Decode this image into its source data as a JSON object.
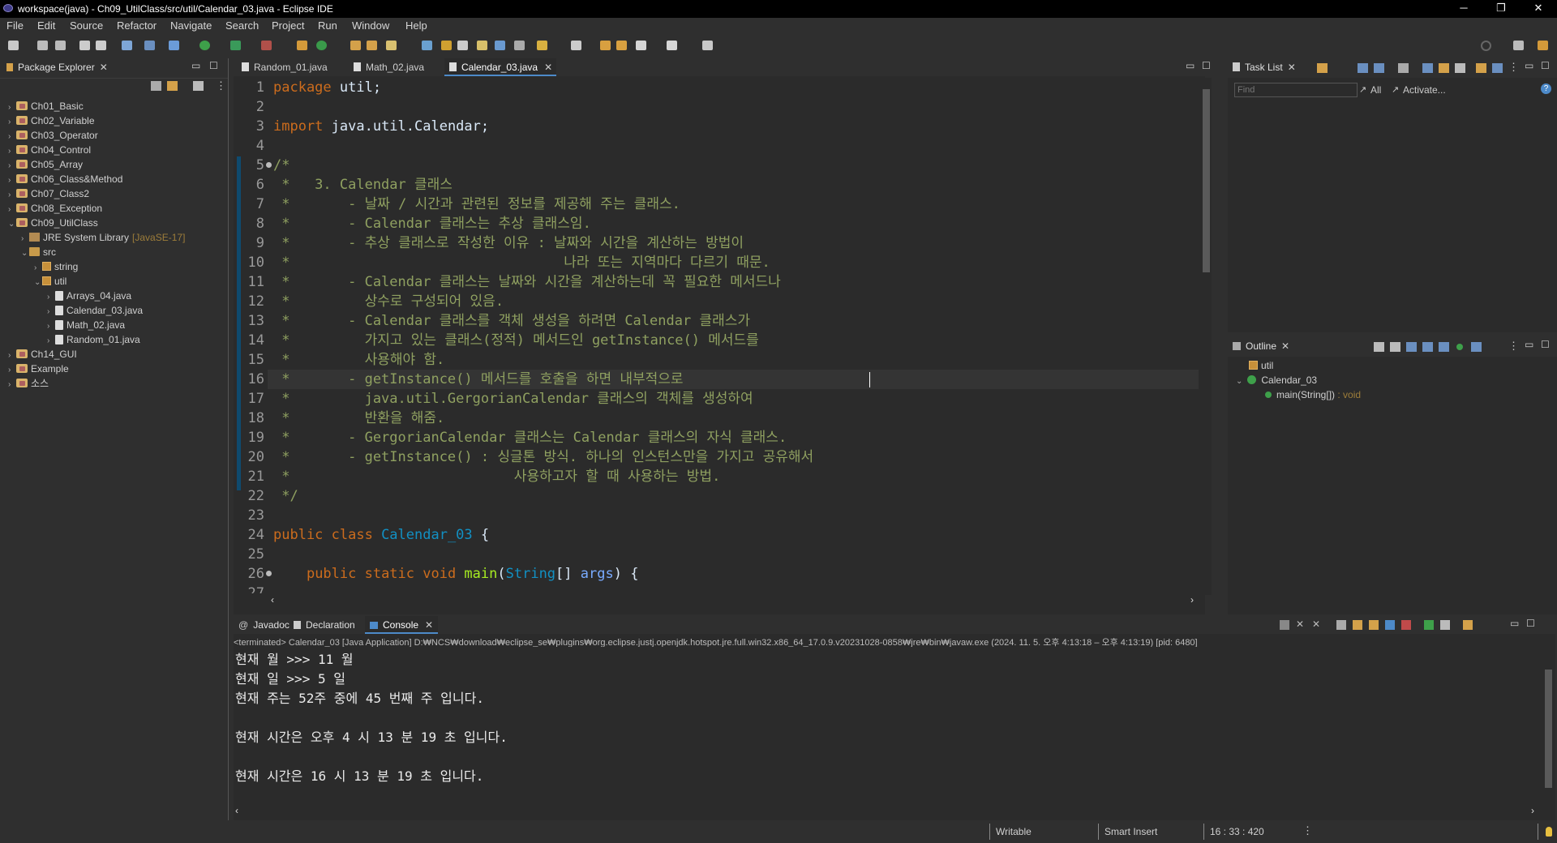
{
  "window": {
    "title": "workspace(java) - Ch09_UtilClass/src/util/Calendar_03.java - Eclipse IDE",
    "controls": [
      "─",
      "❐",
      "✕"
    ]
  },
  "menu": [
    "File",
    "Edit",
    "Source",
    "Refactor",
    "Navigate",
    "Search",
    "Project",
    "Run",
    "Window",
    "Help"
  ],
  "package_explorer": {
    "title": "Package Explorer",
    "tree": [
      {
        "label": "Ch01_Basic",
        "type": "project",
        "indent": 0,
        "arrow": "›"
      },
      {
        "label": "Ch02_Variable",
        "type": "project",
        "indent": 0,
        "arrow": "›"
      },
      {
        "label": "Ch03_Operator",
        "type": "project",
        "indent": 0,
        "arrow": "›"
      },
      {
        "label": "Ch04_Control",
        "type": "project",
        "indent": 0,
        "arrow": "›"
      },
      {
        "label": "Ch05_Array",
        "type": "project",
        "indent": 0,
        "arrow": "›"
      },
      {
        "label": "Ch06_Class&Method",
        "type": "project",
        "indent": 0,
        "arrow": "›"
      },
      {
        "label": "Ch07_Class2",
        "type": "project",
        "indent": 0,
        "arrow": "›"
      },
      {
        "label": "Ch08_Exception",
        "type": "project",
        "indent": 0,
        "arrow": "›"
      },
      {
        "label": "Ch09_UtilClass",
        "type": "project",
        "indent": 0,
        "arrow": "⌄"
      },
      {
        "label": "JRE System Library",
        "suffix": "[JavaSE-17]",
        "type": "library",
        "indent": 1,
        "arrow": "›"
      },
      {
        "label": "src",
        "type": "src",
        "indent": 1,
        "arrow": "⌄"
      },
      {
        "label": "string",
        "type": "package",
        "indent": 2,
        "arrow": "›"
      },
      {
        "label": "util",
        "type": "package",
        "indent": 2,
        "arrow": "⌄"
      },
      {
        "label": "Arrays_04.java",
        "type": "java",
        "indent": 3,
        "arrow": "›"
      },
      {
        "label": "Calendar_03.java",
        "type": "java",
        "indent": 3,
        "arrow": "›"
      },
      {
        "label": "Math_02.java",
        "type": "java",
        "indent": 3,
        "arrow": "›"
      },
      {
        "label": "Random_01.java",
        "type": "java",
        "indent": 3,
        "arrow": "›"
      },
      {
        "label": "Ch14_GUI",
        "type": "project",
        "indent": 0,
        "arrow": "›"
      },
      {
        "label": "Example",
        "type": "project",
        "indent": 0,
        "arrow": "›"
      },
      {
        "label": "소스",
        "type": "project",
        "indent": 0,
        "arrow": "›"
      }
    ]
  },
  "editor": {
    "tabs": [
      {
        "label": "Random_01.java",
        "active": false
      },
      {
        "label": "Math_02.java",
        "active": false
      },
      {
        "label": "Calendar_03.java",
        "active": true
      }
    ],
    "lines": [
      {
        "n": "1",
        "parts": [
          {
            "c": "kw",
            "t": "package"
          },
          {
            "c": "pl",
            "t": " util;"
          }
        ]
      },
      {
        "n": "2",
        "parts": []
      },
      {
        "n": "3",
        "parts": [
          {
            "c": "kw",
            "t": "import"
          },
          {
            "c": "pl",
            "t": " java.util.Calendar;"
          }
        ]
      },
      {
        "n": "4",
        "parts": []
      },
      {
        "n": "5",
        "fold": true,
        "parts": [
          {
            "c": "cm",
            "t": "/*"
          }
        ]
      },
      {
        "n": "6",
        "parts": [
          {
            "c": "cm",
            "t": " *   3. Calendar 클래스"
          }
        ]
      },
      {
        "n": "7",
        "parts": [
          {
            "c": "cm",
            "t": " *       - 날짜 / 시간과 관련된 정보를 제공해 주는 클래스."
          }
        ]
      },
      {
        "n": "8",
        "parts": [
          {
            "c": "cm",
            "t": " *       - Calendar 클래스는 추상 클래스임."
          }
        ]
      },
      {
        "n": "9",
        "parts": [
          {
            "c": "cm",
            "t": " *       - 추상 클래스로 작성한 이유 : 날짜와 시간을 계산하는 방법이"
          }
        ]
      },
      {
        "n": "10",
        "parts": [
          {
            "c": "cm",
            "t": " *                                 나라 또는 지역마다 다르기 때문."
          }
        ]
      },
      {
        "n": "11",
        "parts": [
          {
            "c": "cm",
            "t": " *       - Calendar 클래스는 날짜와 시간을 계산하는데 꼭 필요한 메서드나"
          }
        ]
      },
      {
        "n": "12",
        "parts": [
          {
            "c": "cm",
            "t": " *         상수로 구성되어 있음."
          }
        ]
      },
      {
        "n": "13",
        "parts": [
          {
            "c": "cm",
            "t": " *       - Calendar 클래스를 객체 생성을 하려면 Calendar 클래스가"
          }
        ]
      },
      {
        "n": "14",
        "parts": [
          {
            "c": "cm",
            "t": " *         가지고 있는 클래스(정적) 메서드인 getInstance() 메서드를"
          }
        ]
      },
      {
        "n": "15",
        "parts": [
          {
            "c": "cm",
            "t": " *         사용해야 함."
          }
        ]
      },
      {
        "n": "16",
        "current": true,
        "parts": [
          {
            "c": "cm",
            "t": " *       - getInstance() 메서드를 호출을 하면 내부적으로"
          }
        ]
      },
      {
        "n": "17",
        "parts": [
          {
            "c": "cm",
            "t": " *         java.util.GergorianCalendar 클래스의 객체를 생성하여"
          }
        ]
      },
      {
        "n": "18",
        "parts": [
          {
            "c": "cm",
            "t": " *         반환을 해줌."
          }
        ]
      },
      {
        "n": "19",
        "parts": [
          {
            "c": "cm",
            "t": " *       - GergorianCalendar 클래스는 Calendar 클래스의 자식 클래스."
          }
        ]
      },
      {
        "n": "20",
        "parts": [
          {
            "c": "cm",
            "t": " *       - getInstance() : 싱글톤 방식. 하나의 인스턴스만을 가지고 공유해서"
          }
        ]
      },
      {
        "n": "21",
        "parts": [
          {
            "c": "cm",
            "t": " *                           사용하고자 할 때 사용하는 방법."
          }
        ]
      },
      {
        "n": "22",
        "parts": [
          {
            "c": "cm",
            "t": " */"
          }
        ]
      },
      {
        "n": "23",
        "parts": []
      },
      {
        "n": "24",
        "parts": [
          {
            "c": "kw",
            "t": "public class "
          },
          {
            "c": "cl",
            "t": "Calendar_03"
          },
          {
            "c": "pl",
            "t": " {"
          }
        ]
      },
      {
        "n": "25",
        "parts": []
      },
      {
        "n": "26",
        "fold": true,
        "parts": [
          {
            "c": "pl",
            "t": "    "
          },
          {
            "c": "kw",
            "t": "public static void "
          },
          {
            "c": "mt",
            "t": "main"
          },
          {
            "c": "pl",
            "t": "("
          },
          {
            "c": "cl",
            "t": "String"
          },
          {
            "c": "pl",
            "t": "[] "
          },
          {
            "c": "vr",
            "t": "args"
          },
          {
            "c": "pl",
            "t": ") {"
          }
        ]
      },
      {
        "n": "27",
        "parts": []
      }
    ]
  },
  "task_list": {
    "title": "Task List",
    "find_placeholder": "Find",
    "all_label": "All",
    "activate_label": "Activate..."
  },
  "outline": {
    "title": "Outline",
    "items": [
      {
        "label": "util",
        "indent": 0
      },
      {
        "label": "Calendar_03",
        "indent": 0,
        "arrow": "⌄"
      },
      {
        "label": "main(String[])",
        "suffix": " : void",
        "indent": 1
      }
    ]
  },
  "bottom": {
    "tabs": [
      {
        "label": "Javadoc",
        "active": false
      },
      {
        "label": "Declaration",
        "active": false
      },
      {
        "label": "Console",
        "active": true
      }
    ],
    "terminated": "<terminated> Calendar_03 [Java Application] D:₩NCS₩download₩eclipse_se₩plugins₩org.eclipse.justj.openjdk.hotspot.jre.full.win32.x86_64_17.0.9.v20231028-0858₩jre₩bin₩javaw.exe  (2024. 11. 5. 오후 4:13:18 – 오후 4:13:19) [pid: 6480]",
    "output": [
      "현재 월 >>> 11 월",
      "현재 일 >>> 5 일",
      "현재 주는 52주 중에 45 번째 주 입니다.",
      "",
      "현재 시간은 오후 4 시 13 분 19 초 입니다.",
      "",
      "현재 시간은 16 시 13 분 19 초 입니다."
    ]
  },
  "status": {
    "writable": "Writable",
    "insert_mode": "Smart Insert",
    "position": "16 : 33 : 420"
  },
  "colors": {
    "keyword": "#cc6c1d",
    "comment": "#8fa060",
    "class": "#1290c3",
    "method": "#a7ec21",
    "background": "#2b2b2b"
  }
}
